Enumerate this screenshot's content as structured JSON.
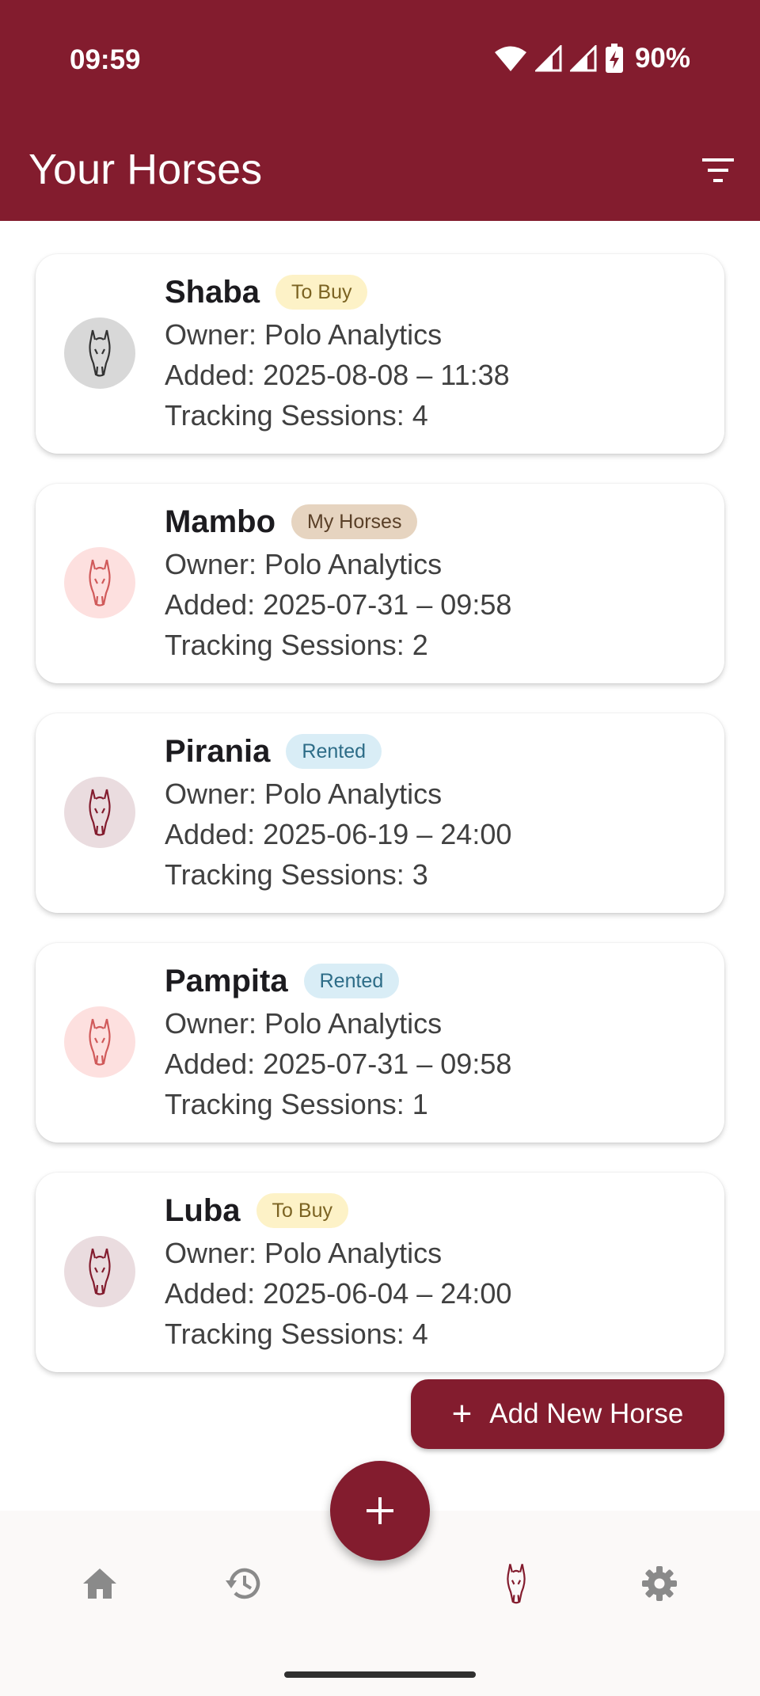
{
  "status": {
    "time": "09:59",
    "battery": "90%"
  },
  "header": {
    "title": "Your Horses"
  },
  "colors": {
    "brand": "#831c2e"
  },
  "horses": [
    {
      "name": "Shaba",
      "badge": "To Buy",
      "owner": "Owner: Polo Analytics",
      "added": "Added: 2025-08-08 – 11:38",
      "sessions": "Tracking Sessions: 4"
    },
    {
      "name": "Mambo",
      "badge": "My Horses",
      "owner": "Owner: Polo Analytics",
      "added": "Added: 2025-07-31 – 09:58",
      "sessions": "Tracking Sessions: 2"
    },
    {
      "name": "Pirania",
      "badge": "Rented",
      "owner": "Owner: Polo Analytics",
      "added": "Added: 2025-06-19 – 24:00",
      "sessions": "Tracking Sessions: 3"
    },
    {
      "name": "Pampita",
      "badge": "Rented",
      "owner": "Owner: Polo Analytics",
      "added": "Added: 2025-07-31 – 09:58",
      "sessions": "Tracking Sessions: 1"
    },
    {
      "name": "Luba",
      "badge": "To Buy",
      "owner": "Owner: Polo Analytics",
      "added": "Added: 2025-06-04 – 24:00",
      "sessions": "Tracking Sessions: 4"
    }
  ],
  "actions": {
    "add_new_label": "Add New Horse"
  },
  "nav": {
    "items": [
      "home-icon",
      "history-icon",
      "horse-icon",
      "settings-icon"
    ],
    "active": "horse-icon"
  }
}
